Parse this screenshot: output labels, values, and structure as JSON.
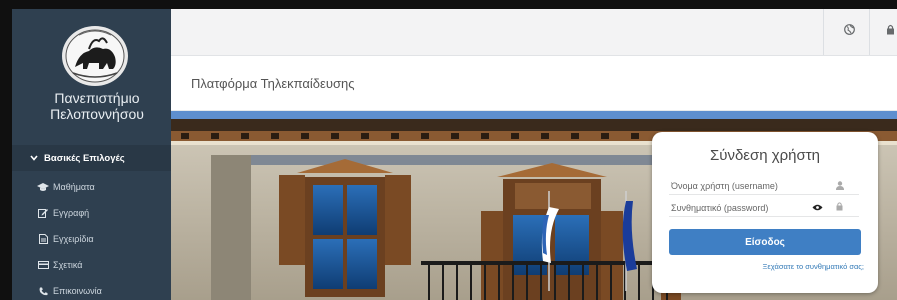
{
  "sidebar": {
    "university_name_line1": "Πανεπιστήμιο",
    "university_name_line2": "Πελοποννήσου",
    "section_label": "Βασικές Επιλογές",
    "items": [
      {
        "label": "Μαθήματα",
        "icon": "graduation-cap-icon"
      },
      {
        "label": "Εγγραφή",
        "icon": "edit-icon"
      },
      {
        "label": "Εγχειρίδια",
        "icon": "document-icon"
      },
      {
        "label": "Σχετικά",
        "icon": "credit-card-icon"
      },
      {
        "label": "Επικοινωνία",
        "icon": "phone-icon"
      }
    ]
  },
  "topbar": {
    "icons": [
      "globe-icon",
      "lock-icon"
    ]
  },
  "page": {
    "title": "Πλατφόρμα Τηλεκπαίδευσης"
  },
  "login": {
    "title": "Σύνδεση χρήστη",
    "username_placeholder": "Όνομα χρήστη (username)",
    "password_placeholder": "Συνθηματικό (password)",
    "submit_label": "Είσοδος",
    "forgot_link": "Ξεχάσατε το συνθηματικό σας;"
  },
  "colors": {
    "sidebar_bg": "#2f4050",
    "primary_button": "#3f7fc4",
    "link": "#337ab7"
  }
}
